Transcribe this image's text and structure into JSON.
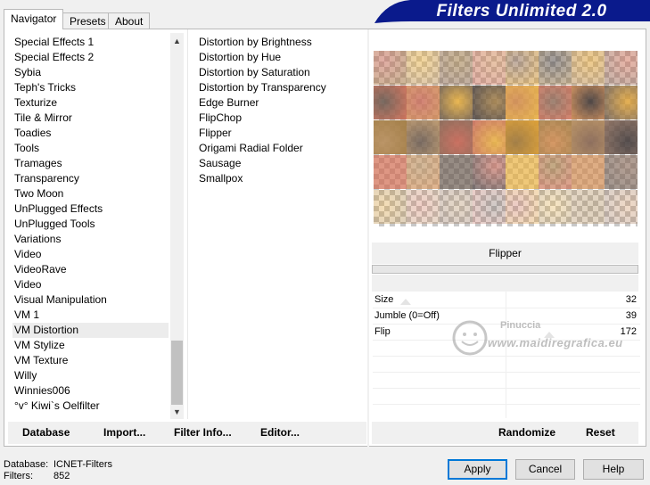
{
  "tabs": [
    {
      "label": "Navigator",
      "active": true
    },
    {
      "label": "Presets",
      "active": false
    },
    {
      "label": "About",
      "active": false
    }
  ],
  "banner": {
    "title": "Filters Unlimited 2.0",
    "color": "#0a1a8c"
  },
  "categories": [
    "Special Effects 1",
    "Special Effects 2",
    "Sybia",
    "Teph's Tricks",
    "Texturize",
    "Tile & Mirror",
    "Toadies",
    "Tools",
    "Tramages",
    "Transparency",
    "Two Moon",
    "UnPlugged Effects",
    "UnPlugged Tools",
    "Variations",
    "Video",
    "VideoRave",
    "Video",
    "Visual Manipulation",
    "VM 1",
    "VM Distortion",
    "VM Stylize",
    "VM Texture",
    "Willy",
    "Winnies006",
    "°v° Kiwi`s Oelfilter"
  ],
  "categories_highlighted_index": 19,
  "filters": [
    "Distortion by Brightness",
    "Distortion by Hue",
    "Distortion by Saturation",
    "Distortion by Transparency",
    "Edge Burner",
    "FlipChop",
    "Flipper",
    "Origami Radial Folder",
    "Sausage",
    "Smallpox"
  ],
  "filters_selected_index": 6,
  "left_buttons": {
    "database": "Database",
    "import": "Import...",
    "filter_info": "Filter Info...",
    "editor": "Editor..."
  },
  "preview": {
    "filter_name": "Flipper"
  },
  "params": [
    {
      "name": "Size",
      "value": "32"
    },
    {
      "name": "Jumble (0=Off)",
      "value": "39"
    },
    {
      "name": "Flip",
      "value": "172"
    }
  ],
  "watermark": {
    "name": "Pinuccia",
    "url": "www.maidiregrafica.eu"
  },
  "right_buttons": {
    "randomize": "Randomize",
    "reset": "Reset"
  },
  "status": {
    "database_label": "Database:",
    "database_value": "ICNET-Filters",
    "filters_label": "Filters:",
    "filters_value": "852"
  },
  "dialog_buttons": {
    "apply": "Apply",
    "cancel": "Cancel",
    "help": "Help"
  },
  "colors": {
    "selection": "#3399ff",
    "default_button_border": "#0078d7"
  }
}
